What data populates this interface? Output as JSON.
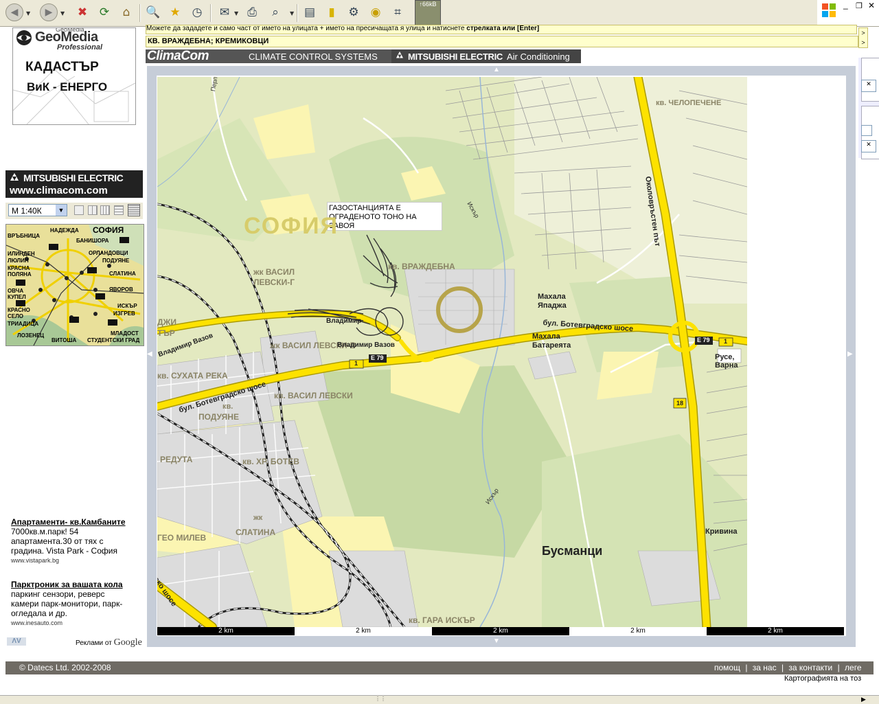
{
  "browser": {
    "throughput": "↑66kB"
  },
  "logo": {
    "brand_small": "GeoMedia",
    "brand": "GeoMedia",
    "edition": "Professional",
    "title": "КАДАСТЪР",
    "subtitle": "ВиК - ЕНЕРГО"
  },
  "left_banner": {
    "line1": "MITSUBISHI ELECTRIC",
    "line2": "www.climacom.com"
  },
  "scale_select": {
    "value": "М 1:40К"
  },
  "minimap": {
    "labels": [
      "НАДЕЖДА",
      "СОФИЯ",
      "ВРЪБНИЦА",
      "БАНИШОРА",
      "ИЛИНДЕН",
      "ОРЛАНДОВЦИ",
      "ЛЮЛИН",
      "ПОДУЯНЕ",
      "КРАСНА ПОЛЯНА",
      "СЛАТИНА",
      "ОВЧА КУПЕЛ",
      "ЯВОРОВ",
      "ИСКЪР",
      "КРАСНО СЕЛО",
      "ИЗГРЕВ",
      "ТРИАДИЦА",
      "ЛОЗЕНЕЦ",
      "ВИТОША",
      "МЛАДОСТ",
      "СТУДЕНТСКИ ГРАД"
    ]
  },
  "ads": [
    {
      "title": "Апартаменти- кв.Камбаните",
      "body": "7000кв.м.парк! 54 апартамента.30 от тях с градина. Vista Park - София",
      "url": "www.vistapark.bg"
    },
    {
      "title": "Парктроник за вашата кола",
      "body": "паркинг сензори, реверс камери парк-монитори, парк-огледала и др.",
      "url": "www.inesauto.com"
    }
  ],
  "ads_footer": {
    "prefix": "Реклами от",
    "brand": "Google",
    "nav": "ΛV"
  },
  "hint_bar": {
    "text": "Можете да зададете и само част от името на улицата + името на пресичащата я улица и натиснете",
    "bold": "стрелката или [Enter]"
  },
  "location_bar": {
    "text": "КВ. ВРАЖДЕБНА; КРЕМИКОВЦИ"
  },
  "brand_bar": {
    "climacom": "ClimaCom",
    "climacom_tag": "CLIMATE CONTROL SYSTEMS",
    "mitsubishi": "MITSUBISHI ELECTRIC",
    "aircon": "Air Conditioning"
  },
  "map": {
    "annotation": "ГАЗОСТАНЦИЯТА Е ОГРАДЕНОТО ТОНО НА ЗАВОЯ",
    "city_label": "СОФИЯ",
    "labels": {
      "vrazhdebna": "кв. ВРАЖДЕБНА",
      "levski_g_1": "жк ВАСИЛ",
      "levski_g_2": "ЛЕВСКИ-Г",
      "levski_v": "жк ВАСИЛ ЛЕВСКИ-В",
      "levski": "кв. ВАСИЛ ЛЕВСКИ",
      "suhata": "кв. СУХАТА РЕКА",
      "poduyane_1": "кв.",
      "poduyane_2": "ПОДУЯНЕ",
      "reduta": "РЕДУТА",
      "hr_botev": "кв. ХР. БОТЕВ",
      "slatina_1": "жк",
      "slatina_2": "СЛАТИНА",
      "milev": "ГЕО МИЛЕВ",
      "gara_iskar": "кв. ГАРА ИСКЪР",
      "busmantsi": "Бусманци",
      "krivina": "Кривина",
      "chelopechene": "кв. ЧЕЛОПЕЧЕНЕ",
      "yapadzha_1": "Махала",
      "yapadzha_2": "Япаджа",
      "batareyata_1": "Махала",
      "batareyata_2": "Батареята",
      "ruse": "Русе, Варна",
      "okolovrasten": "Околовръстен път",
      "botevgradsko_1": "бул. Ботевградско шосе",
      "botevgradsko_2": "бул. Ботевградско шосе",
      "botevgradsko_3": "ско шосе",
      "vladimir": "Владимир Вазов",
      "vladimir_2": "Владимир",
      "vladimir_3": "Владимир Вазов",
      "iskar_1": "Искър",
      "iskar_2": "Искър",
      "perlo": "Перло",
      "dzhi": "ДЖИ",
      "tar": "ТЪР",
      "e79_1": "E 79",
      "e79_2": "E 79",
      "r1_1": "1",
      "r1_2": "1",
      "r18": "18"
    }
  },
  "scale_bar": {
    "labels": [
      "2 km",
      "2 km",
      "2 km",
      "2 km",
      "2 km"
    ]
  },
  "footer": {
    "copyright": "© Datecs Ltd. 2002-2008",
    "links": [
      "помощ",
      "за нас",
      "за контакти",
      "леге"
    ],
    "credit": "Картографията на тоз"
  }
}
